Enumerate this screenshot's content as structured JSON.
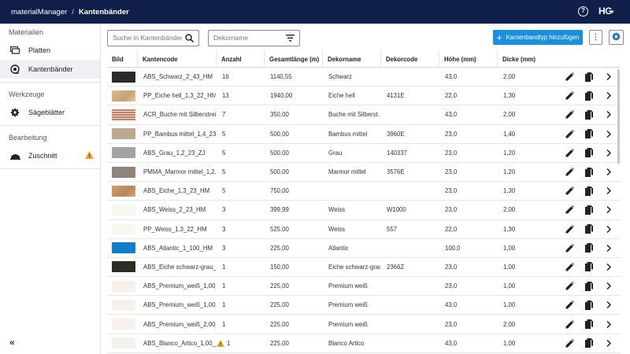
{
  "header": {
    "app_name": "materialManager",
    "separator": "/",
    "current_page": "Kantenbänder",
    "help_icon": "help-icon",
    "logo_text": "HG"
  },
  "sidebar": {
    "sections": [
      {
        "title": "Materialien",
        "items": [
          {
            "label": "Platten",
            "icon": "boards-icon"
          },
          {
            "label": "Kantenbänder",
            "icon": "edgeband-icon",
            "active": true
          }
        ]
      },
      {
        "title": "Werkzeuge",
        "items": [
          {
            "label": "Sägeblätter",
            "icon": "sawblade-icon"
          }
        ]
      },
      {
        "title": "Bearbeitung",
        "items": [
          {
            "label": "Zuschnitt",
            "icon": "cutting-icon",
            "warning": true
          }
        ]
      }
    ],
    "collapse_label": "«"
  },
  "toolbar": {
    "search_placeholder": "Suche in Kantenbänder",
    "filter_placeholder": "Dekorname",
    "add_label": "Kantenbandtyp hinzufügen"
  },
  "table": {
    "columns": [
      "Bild",
      "Kantencode",
      "Anzahl",
      "Gesamtlänge (m)",
      "Dekorname",
      "Dekorcode",
      "Höhe (mm)",
      "Dicke (mm)"
    ],
    "rows": [
      {
        "swatch": "#2b2b2b",
        "code": "ABS_Schwarz_2_43_HM",
        "count": "16",
        "length": "1140,55",
        "decor": "Schwarz",
        "decor_code": "",
        "height": "43,0",
        "thickness": "2,00"
      },
      {
        "swatch": "#d9b789",
        "code": "PP_Eiche hell_1,3_22_HM",
        "count": "13",
        "length": "1940,00",
        "decor": "Eiche hell",
        "decor_code": "4131E",
        "height": "22,0",
        "thickness": "1,30"
      },
      {
        "swatch": "#c58060",
        "code": "ACR_Buche mit Silberstreif...",
        "count": "7",
        "length": "350,00",
        "decor": "Buche mit Silberst...",
        "decor_code": "",
        "height": "43,0",
        "thickness": "2,00"
      },
      {
        "swatch": "#bba88f",
        "code": "PP_Bambus mittel_1,4_23...",
        "count": "5",
        "length": "500,00",
        "decor": "Bambus mittel",
        "decor_code": "3960E",
        "height": "23,0",
        "thickness": "1,40"
      },
      {
        "swatch": "#a3a3a3",
        "code": "ABS_Grau_1,2_23_ZJ",
        "count": "5",
        "length": "500,00",
        "decor": "Grau",
        "decor_code": "140337",
        "height": "23,0",
        "thickness": "1,20"
      },
      {
        "swatch": "#8e857a",
        "code": "PMMA_Marmor mittel_1,2...",
        "count": "5",
        "length": "500,00",
        "decor": "Marmor mittel",
        "decor_code": "3576E",
        "height": "23,0",
        "thickness": "1,20"
      },
      {
        "swatch": "#c99a6a",
        "code": "ABS_Eiche_1,3_23_HM",
        "count": "5",
        "length": "750,00",
        "decor": "",
        "decor_code": "",
        "height": "23,0",
        "thickness": "1,30"
      },
      {
        "swatch": "#f7f6ef",
        "code": "ABS_Weiss_2_23_HM",
        "count": "3",
        "length": "399,99",
        "decor": "Weiss",
        "decor_code": "W1000",
        "height": "23,0",
        "thickness": "2,00"
      },
      {
        "swatch": "#f7f6ef",
        "code": "PP_Weiss_1,3_22_HM",
        "count": "3",
        "length": "525,00",
        "decor": "Weiss",
        "decor_code": "557",
        "height": "22,0",
        "thickness": "1,30"
      },
      {
        "swatch": "#0f7fc8",
        "code": "ABS_Atlantic_1_100_HM",
        "count": "3",
        "length": "225,00",
        "decor": "Atlantic",
        "decor_code": "",
        "height": "100,0",
        "thickness": "1,00"
      },
      {
        "swatch": "#2e2a26",
        "code": "ABS_Eiche schwarz-grau_...",
        "count": "1",
        "length": "150,00",
        "decor": "Eiche schwarz-grau",
        "decor_code": "2366Z",
        "height": "23,0",
        "thickness": "1,00"
      },
      {
        "swatch": "#f6f1ec",
        "code": "ABS_Premium_weiß_1,00_...",
        "count": "1",
        "length": "225,00",
        "decor": "Premium weiß",
        "decor_code": "",
        "height": "23,0",
        "thickness": "1,00"
      },
      {
        "swatch": "#f6f1ec",
        "code": "ABS_Premium_weiß_1,00_...",
        "count": "1",
        "length": "225,00",
        "decor": "Premium weiß",
        "decor_code": "",
        "height": "43,0",
        "thickness": "1,00"
      },
      {
        "swatch": "#f6f1ec",
        "code": "ABS_Premium_weiß_2,00_...",
        "count": "1",
        "length": "225,00",
        "decor": "Premium weiß",
        "decor_code": "",
        "height": "23,0",
        "thickness": "2,00"
      },
      {
        "swatch": "#f2f1ee",
        "code": "ABS_Blanco_Artico_1,00_...",
        "count": "1",
        "length": "225,00",
        "decor": "Blanco Artico",
        "decor_code": "",
        "height": "43,0",
        "thickness": "1,00",
        "warning": true
      }
    ]
  },
  "colors": {
    "topbar": "#0f1f4a",
    "accent": "#1a8fe0",
    "warning": "#f5a623"
  }
}
